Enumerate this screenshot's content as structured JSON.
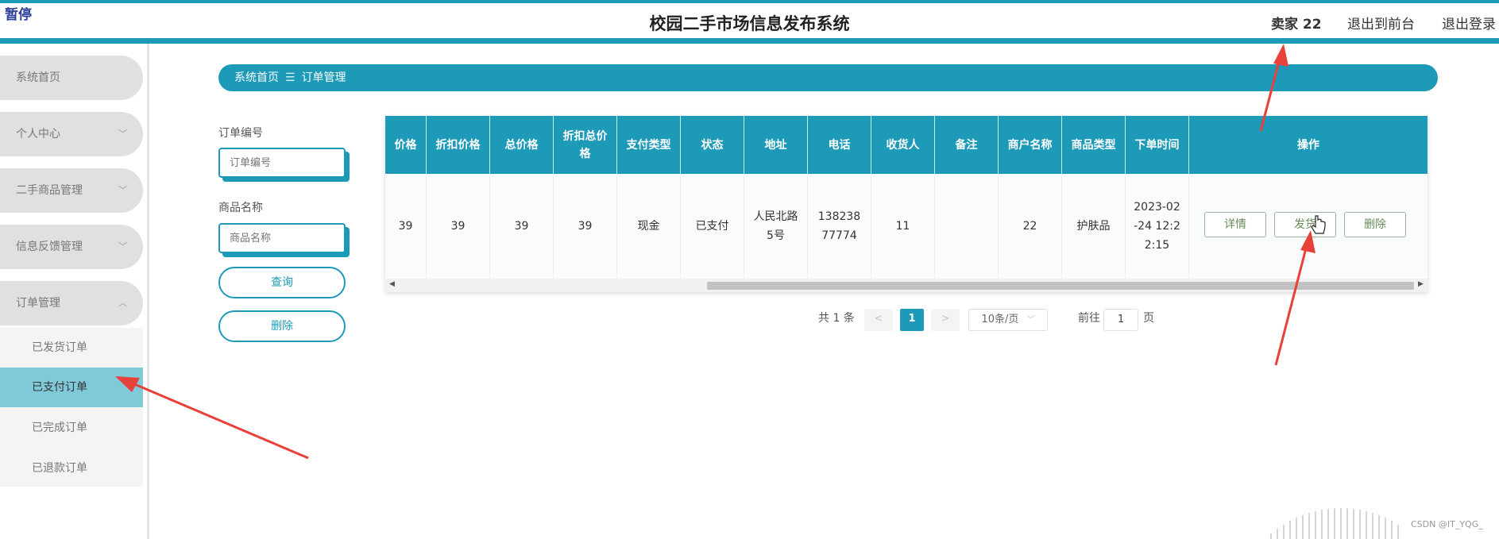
{
  "header": {
    "pause_label": "暂停",
    "title": "校园二手市场信息发布系统",
    "user": "卖家 22",
    "to_front": "退出到前台",
    "logout": "退出登录"
  },
  "sidebar": {
    "items": [
      {
        "label": "系统首页"
      },
      {
        "label": "个人中心"
      },
      {
        "label": "二手商品管理"
      },
      {
        "label": "信息反馈管理"
      },
      {
        "label": "订单管理"
      }
    ],
    "sub_items": [
      {
        "label": "已发货订单"
      },
      {
        "label": "已支付订单"
      },
      {
        "label": "已完成订单"
      },
      {
        "label": "已退款订单"
      }
    ]
  },
  "breadcrumb": {
    "home": "系统首页",
    "sep": "☰",
    "current": "订单管理"
  },
  "filters": {
    "order_no_label": "订单编号",
    "order_no_placeholder": "订单编号",
    "goods_name_label": "商品名称",
    "goods_name_placeholder": "商品名称",
    "query_btn": "查询",
    "delete_btn": "删除"
  },
  "table": {
    "headers": [
      "价格",
      "折扣价格",
      "总价格",
      "折扣总价格",
      "支付类型",
      "状态",
      "地址",
      "电话",
      "收货人",
      "备注",
      "商户名称",
      "商品类型",
      "下单时间",
      "操作"
    ],
    "row": [
      "39",
      "39",
      "39",
      "39",
      "现金",
      "已支付",
      "人民北路5号",
      "13823877774",
      "11",
      "",
      "22",
      "护肤品",
      "2023-02-24 12:22:15"
    ],
    "actions": {
      "detail": "详情",
      "ship": "发货",
      "delete": "删除"
    }
  },
  "pagination": {
    "total": "共 1 条",
    "prev": "<",
    "current": "1",
    "next": ">",
    "page_size": "10条/页",
    "goto": "前往",
    "goto_value": "1",
    "page_unit": "页"
  },
  "watermark": "CSDN @IT_YQG_",
  "colors": {
    "primary": "#1e9ab9",
    "active_submenu": "#7fc9d8",
    "arrow": "#e8413a"
  }
}
